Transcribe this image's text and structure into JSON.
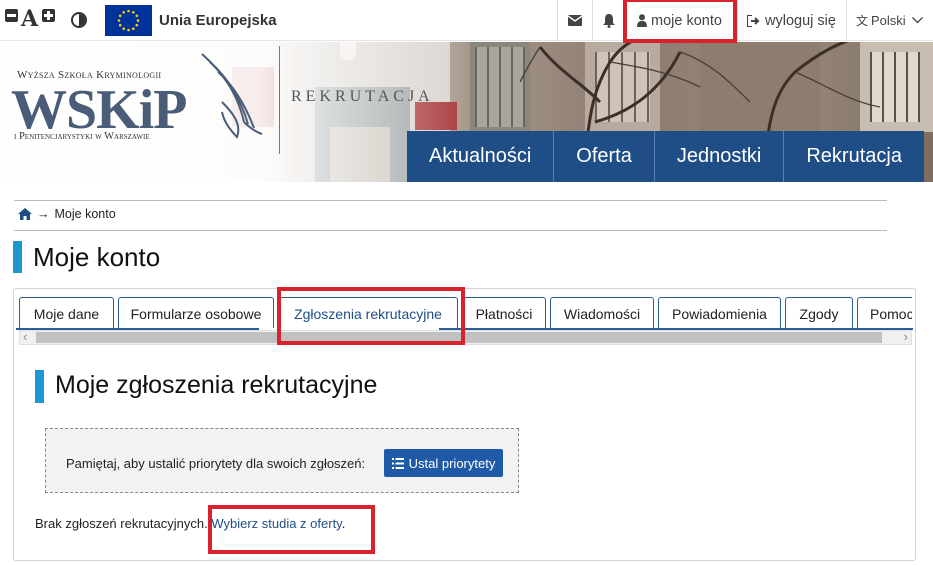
{
  "topbar": {
    "font_decrease": "−",
    "font_size_label": "A",
    "font_increase": "+",
    "eu_label": "Unia Europejska",
    "mail_icon": "envelope-icon",
    "bell_icon": "bell-icon",
    "account_label": "moje konto",
    "logout_label": "wyloguj się",
    "language_label": "Polski"
  },
  "logo": {
    "line_top": "Wyższa Szkoła Kryminologii",
    "abbr": "WSKiP",
    "line_bottom": "i Penitencjarystyki w Warszawie",
    "section": "REKRUTACJA"
  },
  "nav": {
    "items": [
      {
        "label": "Aktualności"
      },
      {
        "label": "Oferta"
      },
      {
        "label": "Jednostki"
      },
      {
        "label": "Rekrutacja"
      }
    ]
  },
  "breadcrumb": {
    "arrow": "→",
    "current": "Moje konto"
  },
  "page": {
    "title": "Moje konto"
  },
  "tabs": [
    {
      "label": "Moje dane"
    },
    {
      "label": "Formularze osobowe"
    },
    {
      "label": "Zgłoszenia rekrutacyjne",
      "active": true
    },
    {
      "label": "Płatności"
    },
    {
      "label": "Wiadomości"
    },
    {
      "label": "Powiadomienia"
    },
    {
      "label": "Zgody"
    },
    {
      "label": "Pomoc"
    }
  ],
  "section": {
    "title": "Moje zgłoszenia rekrutacyjne",
    "notice_text": "Pamiętaj, aby ustalić priorytety dla swoich zgłoszeń:",
    "priority_button": "Ustal priorytety",
    "empty_text": "Brak zgłoszeń rekrutacyjnych.",
    "empty_link": "Wybierz studia z oferty",
    "empty_suffix": "."
  },
  "colors": {
    "nav_bg": "#1f4e87",
    "accent": "#1c97d1",
    "highlight": "#d8222e",
    "button": "#1f5aa8"
  }
}
